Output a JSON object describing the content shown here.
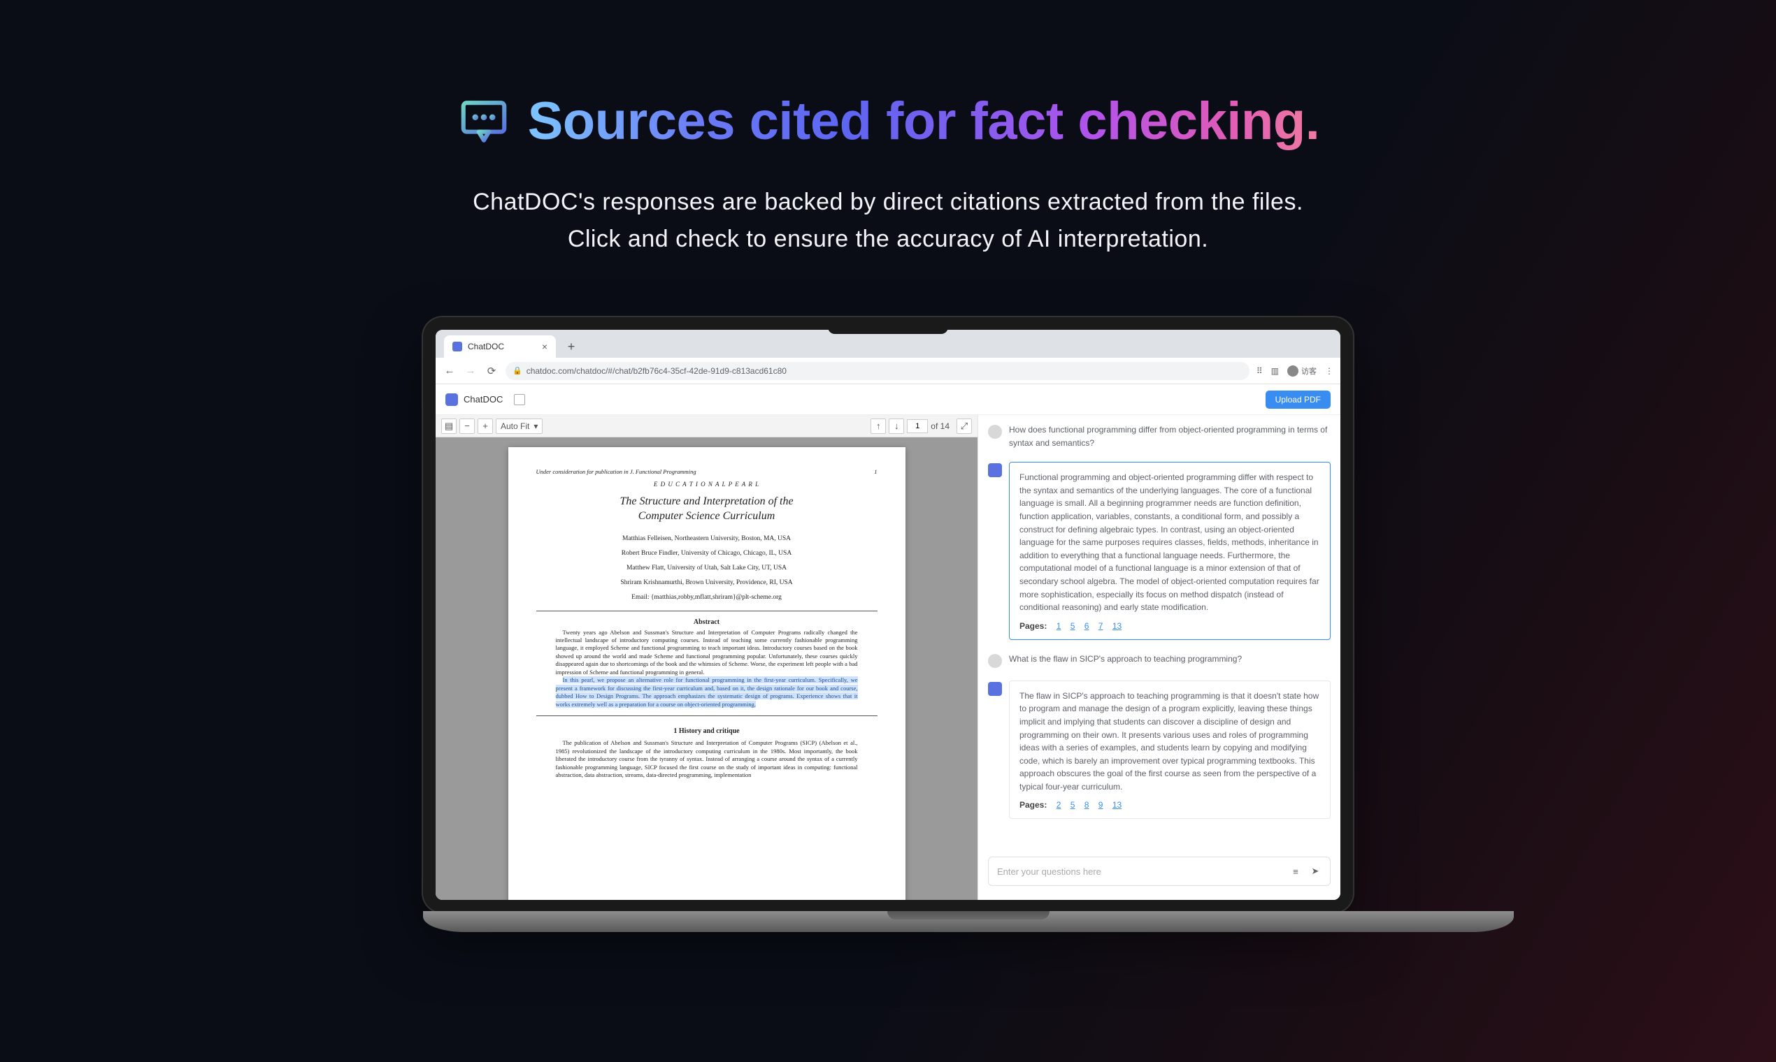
{
  "hero": {
    "title": "Sources cited for fact checking.",
    "sub1": "ChatDOC's responses are backed by direct citations extracted from the files.",
    "sub2": "Click and check to ensure the accuracy of AI interpretation."
  },
  "browser": {
    "tab_title": "ChatDOC",
    "url": "chatdoc.com/chatdoc/#/chat/b2fb76c4-35cf-42de-91d9-c813acd61c80",
    "guest_label": "访客"
  },
  "app": {
    "name": "ChatDOC",
    "upload_btn": "Upload PDF"
  },
  "pdf": {
    "zoom": "Auto Fit",
    "page_current": "1",
    "page_total": "of 14"
  },
  "paper": {
    "running": "Under consideration for publication in J. Functional Programming",
    "pgnum": "1",
    "pearl": "E D U C A T I O N A L   P E A R L",
    "title1": "The Structure and Interpretation of the",
    "title2": "Computer Science Curriculum",
    "authors": [
      "Matthias Felleisen, Northeastern University, Boston, MA, USA",
      "Robert Bruce Findler, University of Chicago, Chicago, IL, USA",
      "Matthew Flatt, University of Utah, Salt Lake City, UT, USA",
      "Shriram Krishnamurthi, Brown University, Providence, RI, USA",
      "Email: {matthias,robby,mflatt,shriram}@plt-scheme.org"
    ],
    "abstract_h": "Abstract",
    "abs_p1": "Twenty years ago Abelson and Sussman's Structure and Interpretation of Computer Programs radically changed the intellectual landscape of introductory computing courses. Instead of teaching some currently fashionable programming language, it employed Scheme and functional programming to teach important ideas. Introductory courses based on the book showed up around the world and made Scheme and functional programming popular. Unfortunately, these courses quickly disappeared again due to shortcomings of the book and the whimsies of Scheme. Worse, the experiment left people with a bad impression of Scheme and functional programming in general.",
    "abs_hl": "In this pearl, we propose an alternative role for functional programming in the first-year curriculum. Specifically, we present a framework for discussing the first-year curriculum and, based on it, the design rationale for our book and course, dubbed How to Design Programs. The approach emphasizes the systematic design of programs. Experience shows that it works extremely well as a preparation for a course on object-oriented programming.",
    "sec1": "1  History and critique",
    "body_p1": "The publication of Abelson and Sussman's Structure and Interpretation of Computer Programs (SICP) (Abelson et al., 1985) revolutionized the landscape of the introductory computing curriculum in the 1980s. Most importantly, the book liberated the introductory course from the tyranny of syntax. Instead of arranging a course around the syntax of a currently fashionable programming language, SICP focused the first course on the study of important ideas in computing: functional abstraction, data abstraction, streams, data-directed programming, implementation"
  },
  "chat": {
    "q1": "How does functional programming differ from object-oriented programming in terms of syntax and semantics?",
    "a1": "Functional programming and object-oriented programming differ with respect to the syntax and semantics of the underlying languages. The core of a functional language is small. All a beginning programmer needs are function definition, function application, variables, constants, a conditional form, and possibly a construct for defining algebraic types. In contrast, using an object-oriented language for the same purposes requires classes, fields, methods, inheritance in addition to everything that a functional language needs. Furthermore, the computational model of a functional language is a minor extension of that of secondary school algebra. The model of object-oriented computation requires far more sophistication, especially its focus on method dispatch (instead of conditional reasoning) and early state modification.",
    "pages_label": "Pages:",
    "a1_pages": [
      "1",
      "5",
      "6",
      "7",
      "13"
    ],
    "q2": "What is the flaw in SICP's approach to teaching programming?",
    "a2": "The flaw in SICP's approach to teaching programming is that it doesn't state how to program and manage the design of a program explicitly, leaving these things implicit and implying that students can discover a discipline of design and programming on their own. It presents various uses and roles of programming ideas with a series of examples, and students learn by copying and modifying code, which is barely an improvement over typical programming textbooks. This approach obscures the goal of the first course as seen from the perspective of a typical four-year curriculum.",
    "a2_pages": [
      "2",
      "5",
      "8",
      "9",
      "13"
    ],
    "input_ph": "Enter your questions here"
  }
}
